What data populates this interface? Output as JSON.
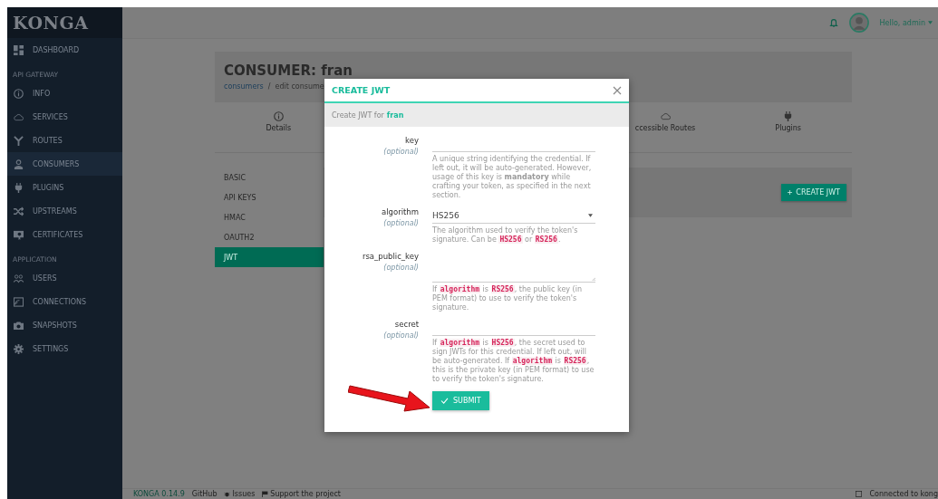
{
  "sidebar": {
    "logo": "KONGA",
    "sections": [
      {
        "items": [
          {
            "label": "DASHBOARD",
            "selected": false
          }
        ]
      },
      {
        "title": "API GATEWAY",
        "items": [
          {
            "label": "INFO",
            "selected": false
          },
          {
            "label": "SERVICES",
            "selected": false
          },
          {
            "label": "ROUTES",
            "selected": false
          },
          {
            "label": "CONSUMERS",
            "selected": true
          },
          {
            "label": "PLUGINS",
            "selected": false
          },
          {
            "label": "UPSTREAMS",
            "selected": false
          },
          {
            "label": "CERTIFICATES",
            "selected": false
          }
        ]
      },
      {
        "title": "APPLICATION",
        "items": [
          {
            "label": "USERS",
            "selected": false
          },
          {
            "label": "CONNECTIONS",
            "selected": false
          },
          {
            "label": "SNAPSHOTS",
            "selected": false
          },
          {
            "label": "SETTINGS",
            "selected": false
          }
        ]
      }
    ]
  },
  "topbar": {
    "greeting": "Hello, admin"
  },
  "page": {
    "title": "CONSUMER: fran",
    "breadcrumb_link": "consumers",
    "breadcrumb_separator": "/",
    "breadcrumb_current": "edit consume"
  },
  "tabs": [
    {
      "label": "Details"
    },
    {
      "label": "ccessible Routes"
    },
    {
      "label": "Plugins"
    }
  ],
  "credentials": [
    {
      "label": "BASIC",
      "selected": false
    },
    {
      "label": "API KEYS",
      "selected": false
    },
    {
      "label": "HMAC",
      "selected": false
    },
    {
      "label": "OAUTH2",
      "selected": false
    },
    {
      "label": "JWT",
      "selected": true
    }
  ],
  "create_button": "CREATE JWT",
  "modal": {
    "title": "CREATE JWT",
    "subtitle": "Create JWT for",
    "subtitle_name": "fran",
    "submit": "SUBMIT",
    "fields": [
      {
        "label": "key",
        "note": "(optional)",
        "kind": "text",
        "help": [
          {
            "kind": "text",
            "text": "A unique string identifying the credential. If left out, it will be auto-generated. However, usage of this key is **mandatory** while crafting your token, as specified in the next section."
          }
        ]
      },
      {
        "label": "algorithm",
        "note": "(optional)",
        "kind": "select",
        "value": "HS256",
        "help": [
          {
            "kind": "text",
            "text": "The algorithm used to verify the token's signature. Can be "
          },
          {
            "kind": "code",
            "text": "HS256"
          },
          {
            "kind": "text",
            "text": " or "
          },
          {
            "kind": "code",
            "text": "RS256"
          },
          {
            "kind": "text",
            "text": "."
          }
        ]
      },
      {
        "label": "rsa_public_key",
        "note": "(optional)",
        "kind": "textarea",
        "help": [
          {
            "kind": "text",
            "text": "If "
          },
          {
            "kind": "code",
            "text": "algorithm"
          },
          {
            "kind": "text",
            "text": " is "
          },
          {
            "kind": "code",
            "text": "RS256"
          },
          {
            "kind": "text",
            "text": ", the public key (in PEM format) to use to verify the token's signature."
          }
        ]
      },
      {
        "label": "secret",
        "note": "(optional)",
        "kind": "text",
        "help": [
          {
            "kind": "text",
            "text": "If "
          },
          {
            "kind": "code",
            "text": "algorithm"
          },
          {
            "kind": "text",
            "text": " is "
          },
          {
            "kind": "code",
            "text": "HS256"
          },
          {
            "kind": "text",
            "text": ", the secret used to sign JWTs for this credential. If left out, will be auto-generated. If "
          },
          {
            "kind": "code",
            "text": "algorithm"
          },
          {
            "kind": "text",
            "text": " is "
          },
          {
            "kind": "code",
            "text": "RS256"
          },
          {
            "kind": "text",
            "text": ", this is the private key (in PEM format) to use to verify the token's signature."
          }
        ]
      }
    ]
  },
  "footer": {
    "version": "KONGA 0.14.9",
    "links": [
      {
        "label": "GitHub"
      },
      {
        "label": "Issues"
      },
      {
        "label": "Support the project"
      }
    ],
    "status": "Connected to kong"
  }
}
